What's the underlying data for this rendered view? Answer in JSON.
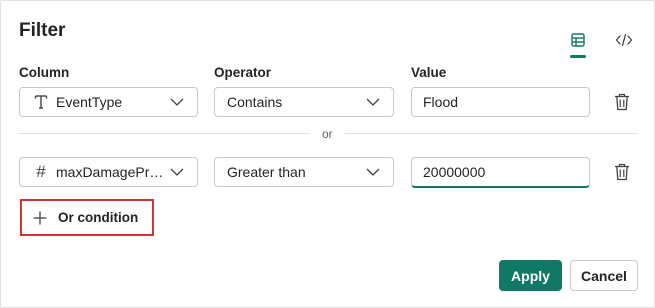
{
  "dialog": {
    "title": "Filter",
    "view_tabs": [
      {
        "icon": "table-icon",
        "active": true
      },
      {
        "icon": "code-icon",
        "active": false
      }
    ]
  },
  "columns": {
    "column_label": "Column",
    "operator_label": "Operator",
    "value_label": "Value"
  },
  "conditions": [
    {
      "column_icon_glyph": "T",
      "column": "EventType",
      "operator": "Contains",
      "value": "Flood"
    },
    {
      "column_icon_glyph": "#",
      "column": "maxDamageProperty",
      "operator": "Greater than",
      "value": "20000000"
    }
  ],
  "separator": {
    "label": "or"
  },
  "or_condition": {
    "label": "Or condition"
  },
  "footer": {
    "apply_label": "Apply",
    "cancel_label": "Cancel"
  },
  "colors": {
    "accent": "#117865",
    "highlight_border": "#d13438"
  }
}
